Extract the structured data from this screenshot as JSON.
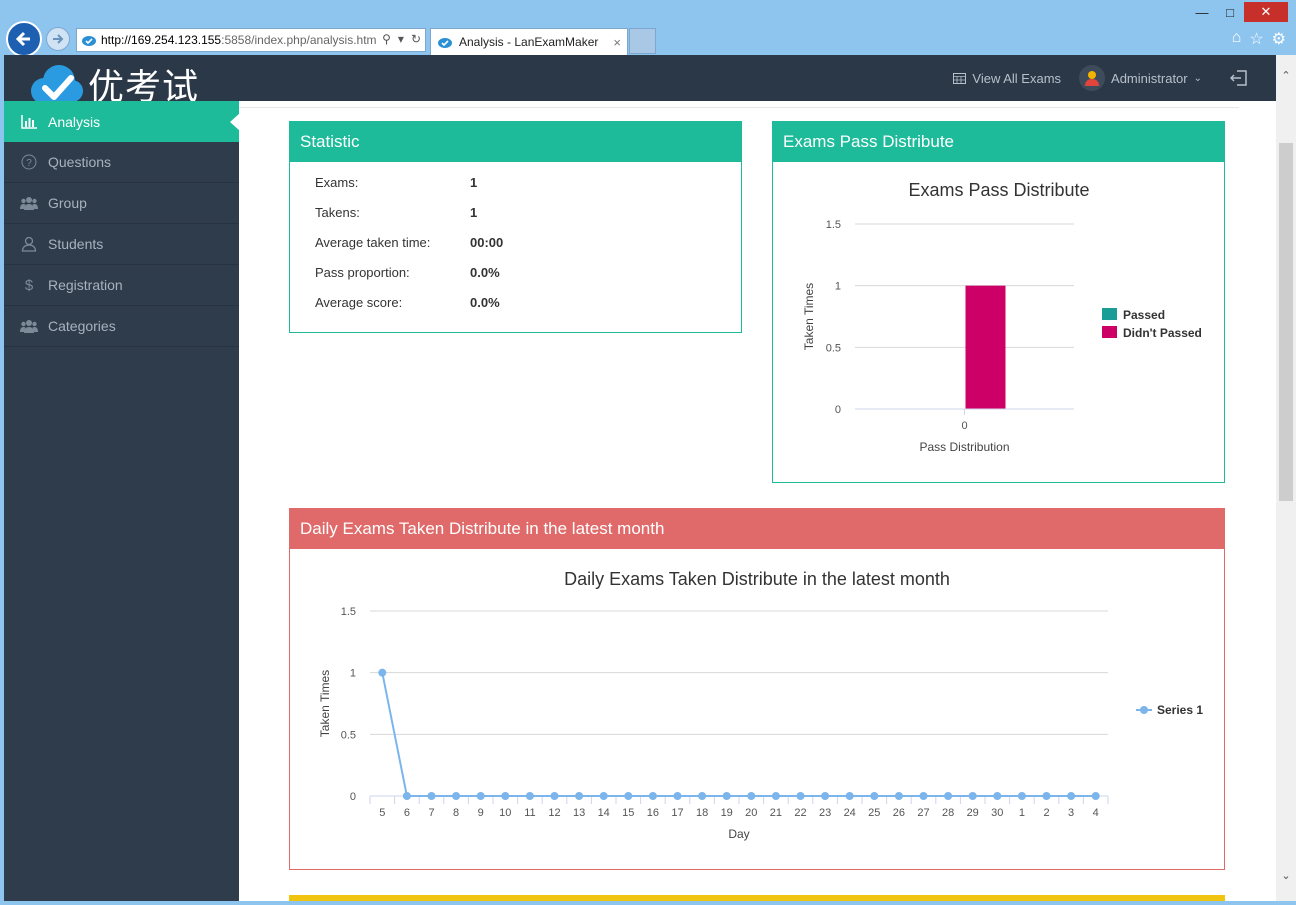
{
  "browser": {
    "url_host": "http://169.254.123.155",
    "url_rest": ":5858/index.php/analysis.htm",
    "tab_title": "Analysis - LanExamMaker",
    "tab_close": "×"
  },
  "header": {
    "logo_text": "优考试",
    "view_all_exams": "View All Exams",
    "user_name": "Administrator"
  },
  "sidebar": {
    "items": [
      {
        "label": "Analysis",
        "icon": "bar-chart-icon"
      },
      {
        "label": "Questions",
        "icon": "question-circle-icon"
      },
      {
        "label": "Group",
        "icon": "users-icon"
      },
      {
        "label": "Students",
        "icon": "user-icon"
      },
      {
        "label": "Registration",
        "icon": "dollar-icon"
      },
      {
        "label": "Categories",
        "icon": "users-icon"
      }
    ]
  },
  "statistic": {
    "title": "Statistic",
    "rows": [
      {
        "label": "Exams:",
        "value": "1"
      },
      {
        "label": "Takens:",
        "value": "1"
      },
      {
        "label": "Average taken time:",
        "value": "00:00"
      },
      {
        "label": "Pass proportion:",
        "value": "0.0%"
      },
      {
        "label": "Average score:",
        "value": "0.0%"
      }
    ]
  },
  "pass_panel": {
    "title": "Exams Pass Distribute"
  },
  "daily_panel": {
    "title": "Daily Exams Taken Distribute in the latest month"
  },
  "colors": {
    "accent": "#1dbb99",
    "red": "#e06a6a",
    "passed": "#1a9d96",
    "didnt_passed": "#cc0066",
    "line": "#7cb5ec",
    "yellow": "#f1c40f"
  },
  "chart_data": [
    {
      "type": "bar",
      "title": "Exams Pass Distribute",
      "xlabel": "Pass Distribution",
      "ylabel": "Taken Times",
      "categories": [
        "0"
      ],
      "ylim": [
        0,
        1.5
      ],
      "yticks": [
        "0",
        "0.5",
        "1",
        "1.5"
      ],
      "legend": "right",
      "series": [
        {
          "name": "Passed",
          "values": [
            0
          ]
        },
        {
          "name": "Didn't Passed",
          "values": [
            1
          ]
        }
      ]
    },
    {
      "type": "line",
      "title": "Daily Exams Taken Distribute in the latest month",
      "xlabel": "Day",
      "ylabel": "Taken Times",
      "categories": [
        "5",
        "6",
        "7",
        "8",
        "9",
        "10",
        "11",
        "12",
        "13",
        "14",
        "15",
        "16",
        "17",
        "18",
        "19",
        "20",
        "21",
        "22",
        "23",
        "24",
        "25",
        "26",
        "27",
        "28",
        "29",
        "30",
        "1",
        "2",
        "3",
        "4"
      ],
      "ylim": [
        0,
        1.5
      ],
      "yticks": [
        "0",
        "0.5",
        "1",
        "1.5"
      ],
      "legend": "right",
      "series": [
        {
          "name": "Series 1",
          "values": [
            1,
            0,
            0,
            0,
            0,
            0,
            0,
            0,
            0,
            0,
            0,
            0,
            0,
            0,
            0,
            0,
            0,
            0,
            0,
            0,
            0,
            0,
            0,
            0,
            0,
            0,
            0,
            0,
            0,
            0
          ]
        }
      ]
    }
  ]
}
